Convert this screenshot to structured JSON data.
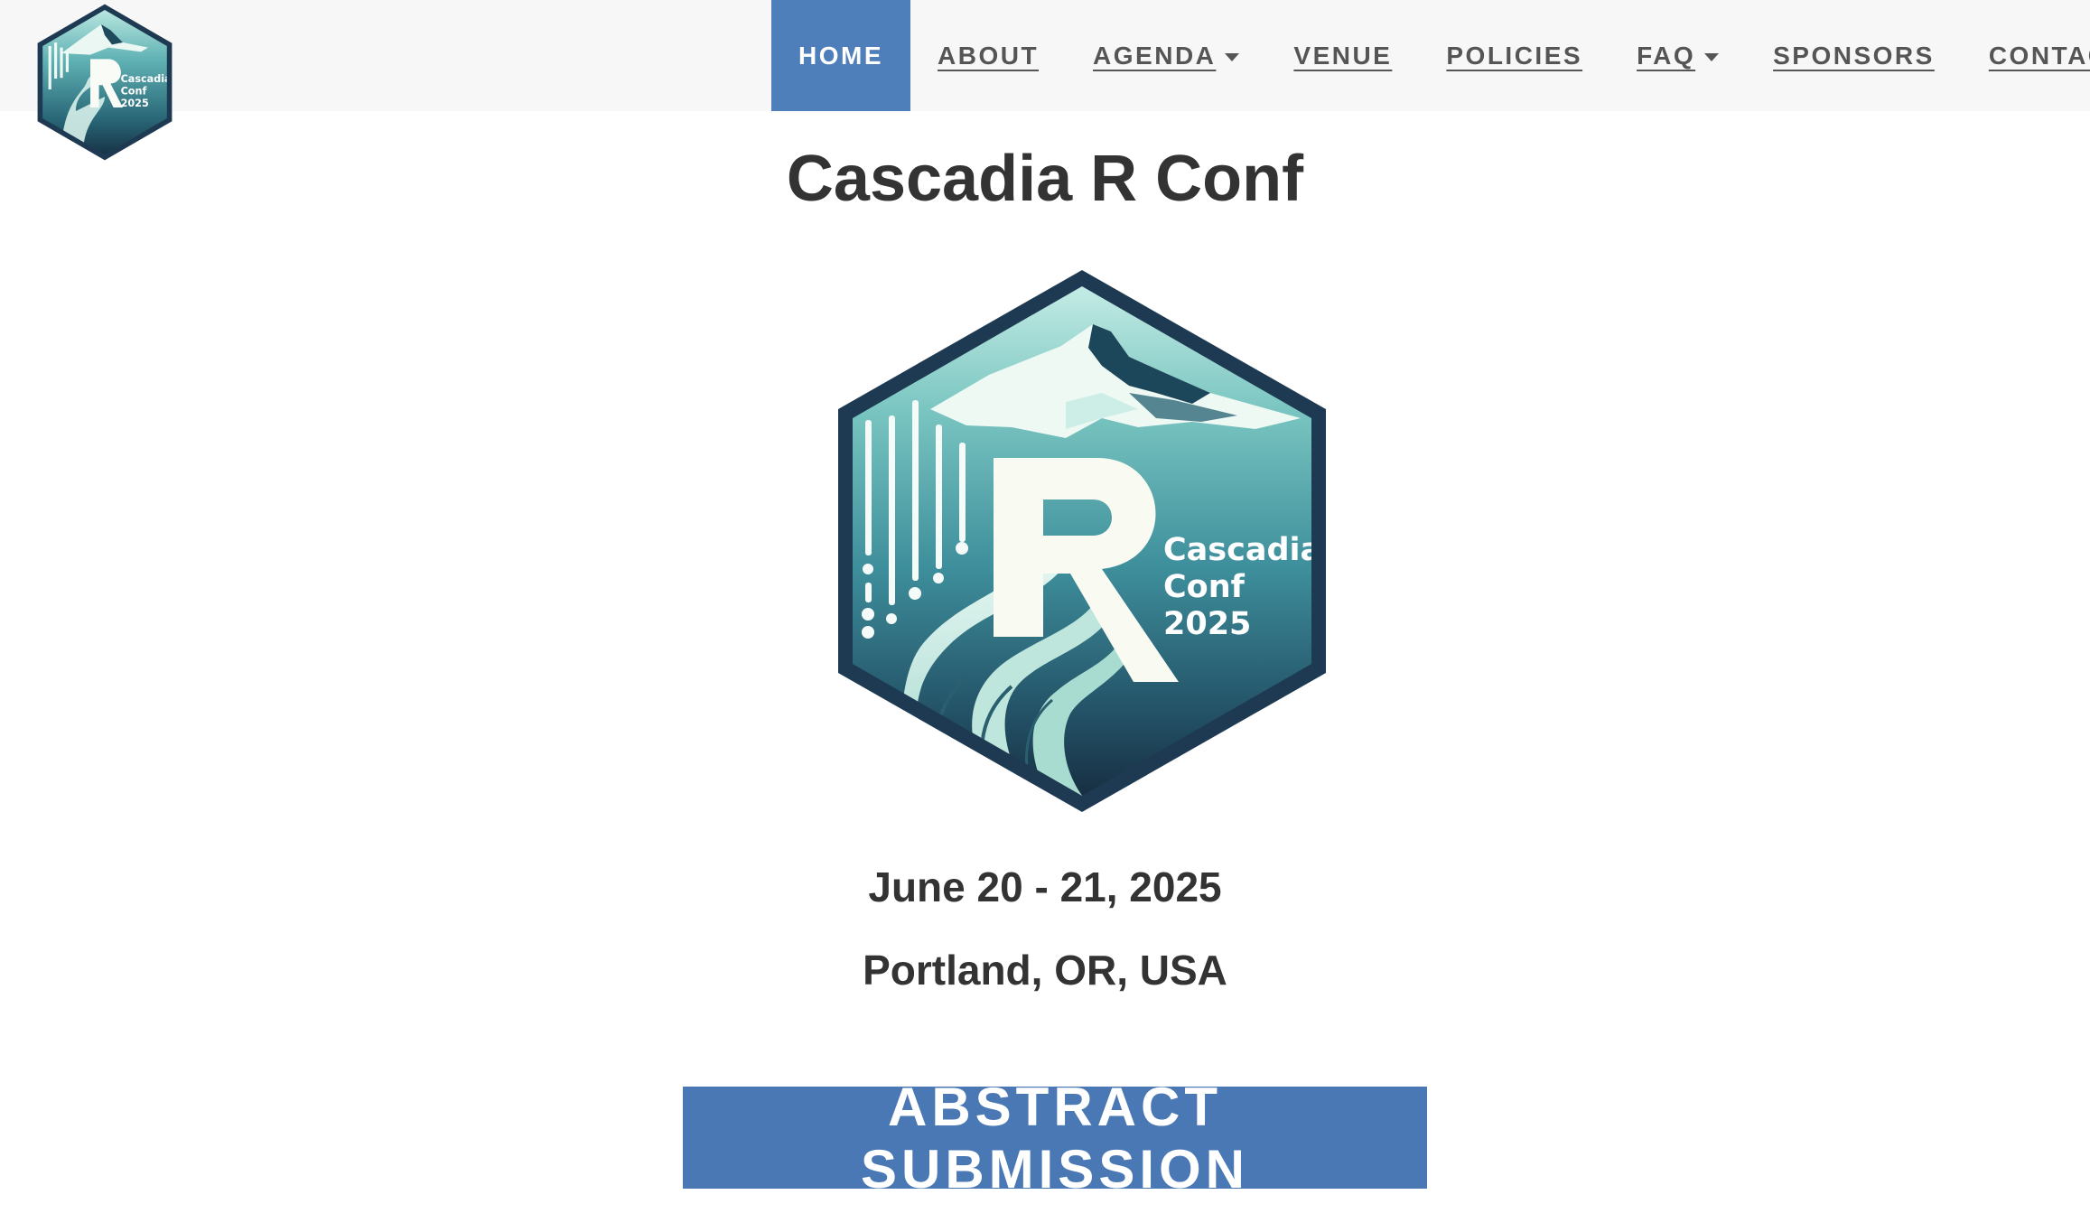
{
  "nav": {
    "items": [
      {
        "label": "HOME",
        "active": true,
        "dropdown": false
      },
      {
        "label": "ABOUT",
        "active": false,
        "dropdown": false
      },
      {
        "label": "AGENDA",
        "active": false,
        "dropdown": true
      },
      {
        "label": "VENUE",
        "active": false,
        "dropdown": false
      },
      {
        "label": "POLICIES",
        "active": false,
        "dropdown": false
      },
      {
        "label": "FAQ",
        "active": false,
        "dropdown": true
      },
      {
        "label": "SPONSORS",
        "active": false,
        "dropdown": false
      },
      {
        "label": "CONTACT",
        "active": false,
        "dropdown": false
      }
    ]
  },
  "logo": {
    "line1": "Cascadia",
    "line2": "Conf",
    "line3": "2025",
    "letter": "R"
  },
  "main": {
    "title": "Cascadia R Conf",
    "date": "June 20 - 21, 2025",
    "location": "Portland, OR, USA",
    "cta_label": "ABSTRACT SUBMISSION"
  },
  "colors": {
    "nav_bg": "#f7f7f7",
    "nav_active_bg": "#4f7fba",
    "cta_bg": "#4a78b5",
    "text": "#333333",
    "logo_border": "#1e3a52",
    "logo_teal_top": "#7fc9c4",
    "logo_teal_bottom": "#173a4e"
  }
}
